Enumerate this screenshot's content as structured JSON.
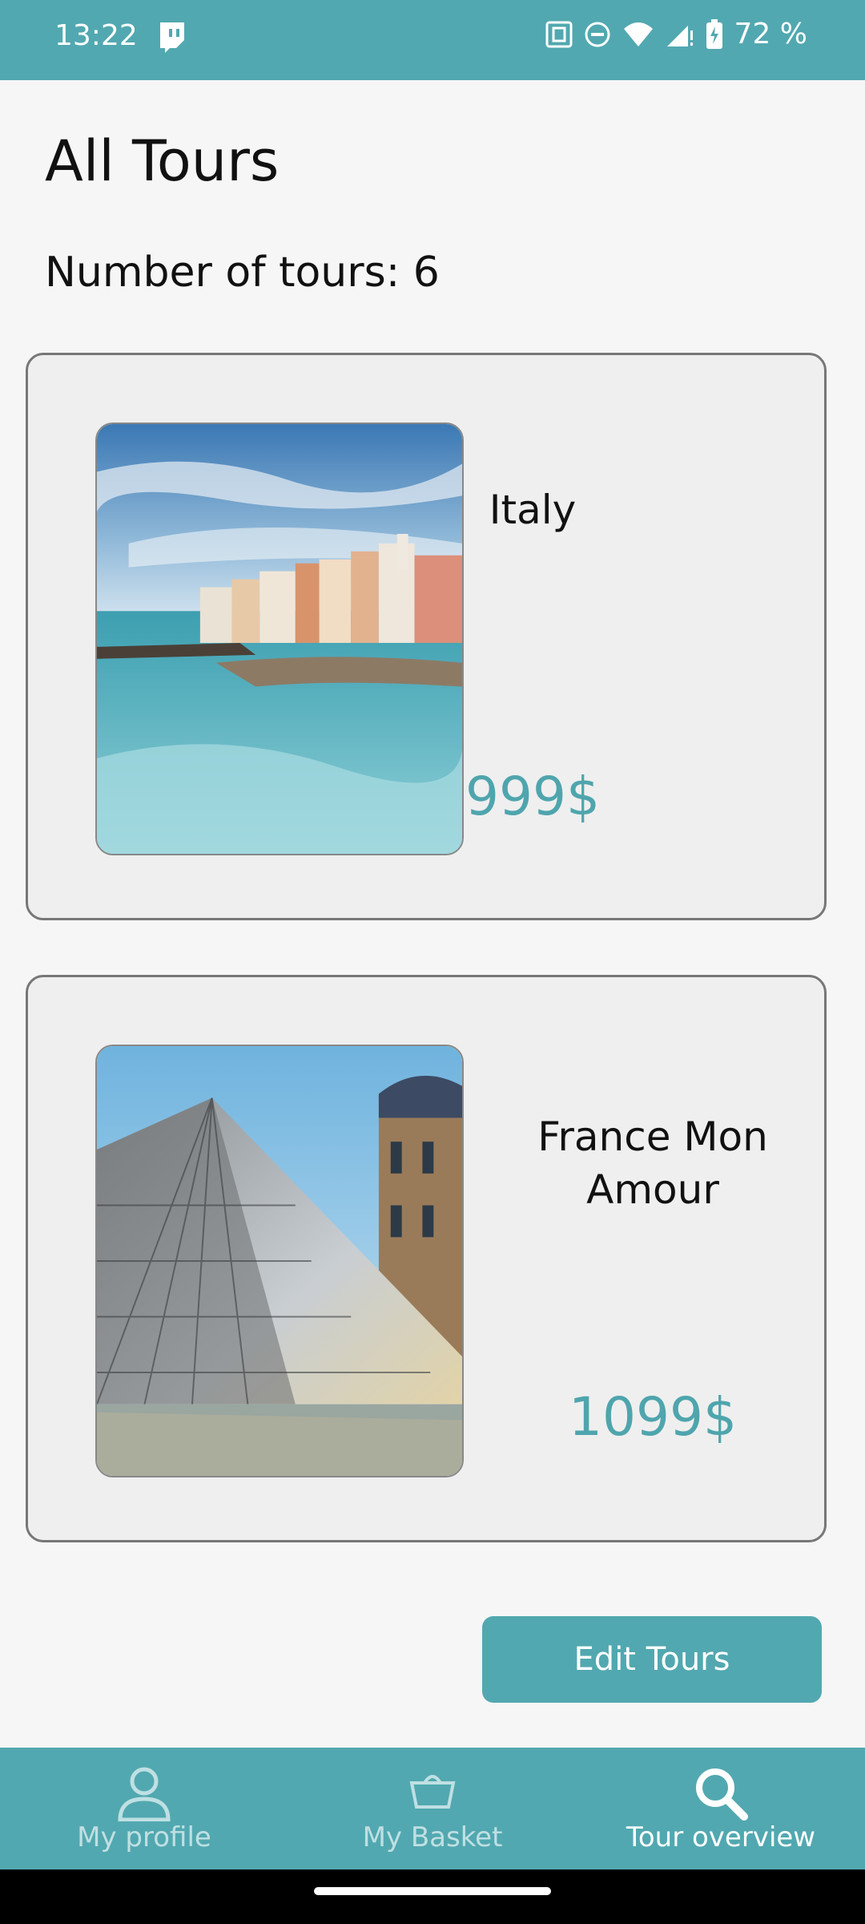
{
  "status_bar": {
    "time": "13:22",
    "battery": "72 %",
    "icons": [
      "twitch-icon",
      "nfc-icon",
      "dnd-icon",
      "wifi-icon",
      "signal-icon",
      "battery-icon"
    ]
  },
  "page": {
    "title": "All Tours",
    "count_label": "Number of tours: 6"
  },
  "tours": [
    {
      "name": "Italy",
      "price": "999$",
      "image": "italian-coast-town-photo"
    },
    {
      "name": "France Mon Amour",
      "price": "1099$",
      "image": "louvre-pyramid-photo"
    }
  ],
  "actions": {
    "edit_label": "Edit Tours"
  },
  "nav": {
    "items": [
      {
        "label": "My profile",
        "icon": "person-icon",
        "active": false
      },
      {
        "label": "My Basket",
        "icon": "basket-icon",
        "active": false
      },
      {
        "label": "Tour overview",
        "icon": "search-icon",
        "active": true
      }
    ]
  },
  "colors": {
    "accent": "#52a8b0",
    "price": "#4fa5ad",
    "card_bg": "#efefef"
  }
}
